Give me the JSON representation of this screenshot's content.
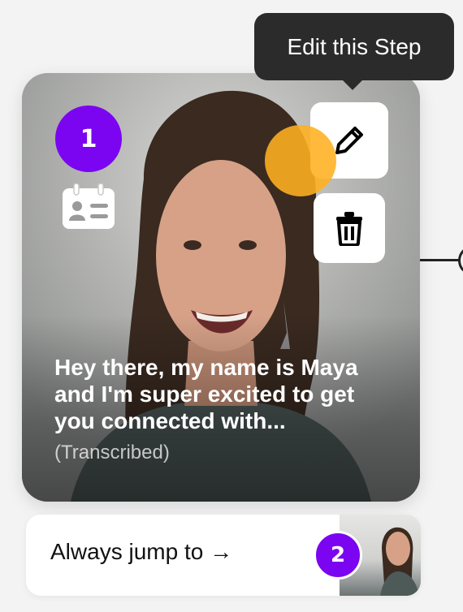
{
  "tooltip": {
    "text": "Edit this Step"
  },
  "step": {
    "number": "1",
    "caption": "Hey there, my name is Maya and I'm super excited to get you connected with...",
    "caption_note": "(Transcribed)",
    "type_icon": "contact-card-icon",
    "actions": [
      {
        "name": "edit",
        "icon": "pencil-icon"
      },
      {
        "name": "delete",
        "icon": "trash-icon"
      }
    ]
  },
  "jump": {
    "label": "Always jump to →",
    "target_step_number": "2"
  },
  "colors": {
    "accent": "#7b05f0",
    "tooltip_bg": "#2b2b2b",
    "click_indicator": "#ffb020",
    "background": "#f3f3f3"
  }
}
